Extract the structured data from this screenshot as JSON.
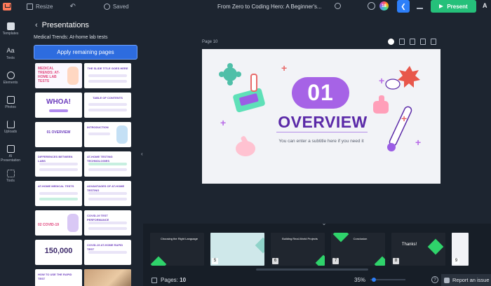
{
  "toolbar": {
    "resize_label": "Resize",
    "saved_label": "Saved",
    "document_title": "From Zero to Coding Hero: A Beginner's...",
    "avatar_badge": "18",
    "present_label": "Present",
    "right_glyph": "A"
  },
  "rail": {
    "items": [
      {
        "label": "Templates",
        "icon": "templates-icon"
      },
      {
        "label": "Texts",
        "icon": "text-icon"
      },
      {
        "label": "Elements",
        "icon": "elements-icon"
      },
      {
        "label": "Photos",
        "icon": "photos-icon"
      },
      {
        "label": "Uploads",
        "icon": "uploads-icon"
      },
      {
        "label": "AI Presentation",
        "icon": "ai-presentation-icon"
      },
      {
        "label": "Tools",
        "icon": "tools-icon"
      }
    ]
  },
  "panel": {
    "title": "Presentations",
    "subtitle": "Medical Trends: At-home lab tests",
    "apply_label": "Apply remaining pages",
    "thumbs": [
      {
        "label": "MEDICAL TRENDS: AT-HOME LAB TESTS"
      },
      {
        "label": "THE SLIDE TITLE GOES HERE"
      },
      {
        "label": "WHOA!"
      },
      {
        "label": "TABLE OF CONTENTS"
      },
      {
        "label": "01 OVERVIEW"
      },
      {
        "label": "INTRODUCTION"
      },
      {
        "label": "DIFFERENCES BETWEEN LABS"
      },
      {
        "label": "AT-HOME TESTING TECHNOLOGIES"
      },
      {
        "label": "AT-HOME MEDICAL TESTS"
      },
      {
        "label": "ADVANTAGES OF AT-HOME TESTING"
      },
      {
        "label": "02 COVID-19"
      },
      {
        "label": "COVID-19 TEST PERFORMANCE"
      },
      {
        "label": "150,000"
      },
      {
        "label": "COVID-19 AT-HOME RAPID TEST"
      },
      {
        "label": "HOW TO USE THE RAPID TEST"
      },
      {
        "label": ""
      }
    ]
  },
  "canvas": {
    "page_label": "Page 10",
    "slide": {
      "number": "01",
      "heading": "OVERVIEW",
      "subtitle": "You can enter a subtitle here if you need it"
    }
  },
  "strip": {
    "thumbs": [
      {
        "num": "",
        "caption": "Choosing the Right Language"
      },
      {
        "num": "5",
        "caption": ""
      },
      {
        "num": "6",
        "caption": "Building Real-World Projects"
      },
      {
        "num": "7",
        "caption": "Conclusion"
      },
      {
        "num": "8",
        "caption": "Thanks!"
      },
      {
        "num": "9",
        "caption": ""
      }
    ]
  },
  "footer": {
    "pages_label": "Pages:",
    "pages_count": "10",
    "zoom": "35%",
    "report_label": "Report an issue"
  },
  "colors": {
    "accent": "#2d7ff9",
    "present_green": "#25c07a",
    "slide_purple": "#a663e6",
    "heading_purple": "#5b2aa8",
    "strip_green": "#2fd36b"
  }
}
